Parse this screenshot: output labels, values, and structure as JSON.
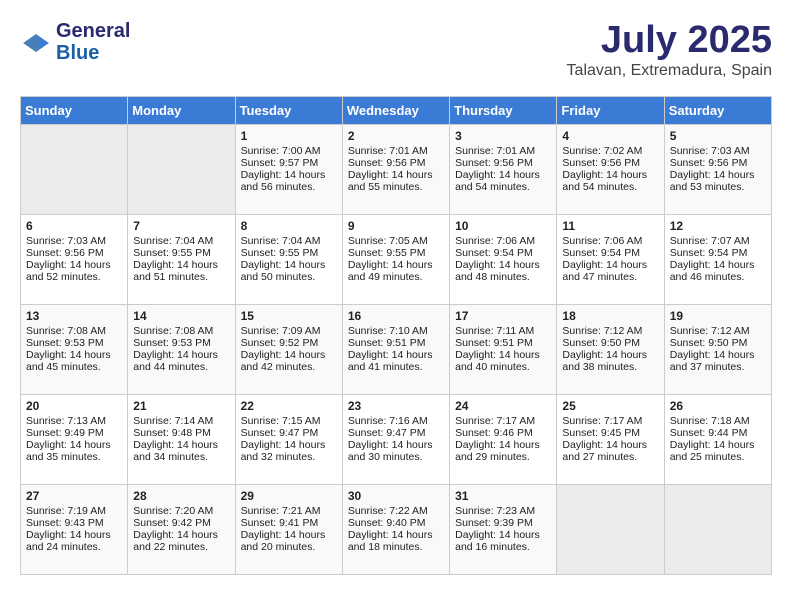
{
  "header": {
    "logo_line1": "General",
    "logo_line2": "Blue",
    "month": "July 2025",
    "location": "Talavan, Extremadura, Spain"
  },
  "weekdays": [
    "Sunday",
    "Monday",
    "Tuesday",
    "Wednesday",
    "Thursday",
    "Friday",
    "Saturday"
  ],
  "weeks": [
    [
      {
        "day": "",
        "sunrise": "",
        "sunset": "",
        "daylight": ""
      },
      {
        "day": "",
        "sunrise": "",
        "sunset": "",
        "daylight": ""
      },
      {
        "day": "1",
        "sunrise": "Sunrise: 7:00 AM",
        "sunset": "Sunset: 9:57 PM",
        "daylight": "Daylight: 14 hours and 56 minutes."
      },
      {
        "day": "2",
        "sunrise": "Sunrise: 7:01 AM",
        "sunset": "Sunset: 9:56 PM",
        "daylight": "Daylight: 14 hours and 55 minutes."
      },
      {
        "day": "3",
        "sunrise": "Sunrise: 7:01 AM",
        "sunset": "Sunset: 9:56 PM",
        "daylight": "Daylight: 14 hours and 54 minutes."
      },
      {
        "day": "4",
        "sunrise": "Sunrise: 7:02 AM",
        "sunset": "Sunset: 9:56 PM",
        "daylight": "Daylight: 14 hours and 54 minutes."
      },
      {
        "day": "5",
        "sunrise": "Sunrise: 7:03 AM",
        "sunset": "Sunset: 9:56 PM",
        "daylight": "Daylight: 14 hours and 53 minutes."
      }
    ],
    [
      {
        "day": "6",
        "sunrise": "Sunrise: 7:03 AM",
        "sunset": "Sunset: 9:56 PM",
        "daylight": "Daylight: 14 hours and 52 minutes."
      },
      {
        "day": "7",
        "sunrise": "Sunrise: 7:04 AM",
        "sunset": "Sunset: 9:55 PM",
        "daylight": "Daylight: 14 hours and 51 minutes."
      },
      {
        "day": "8",
        "sunrise": "Sunrise: 7:04 AM",
        "sunset": "Sunset: 9:55 PM",
        "daylight": "Daylight: 14 hours and 50 minutes."
      },
      {
        "day": "9",
        "sunrise": "Sunrise: 7:05 AM",
        "sunset": "Sunset: 9:55 PM",
        "daylight": "Daylight: 14 hours and 49 minutes."
      },
      {
        "day": "10",
        "sunrise": "Sunrise: 7:06 AM",
        "sunset": "Sunset: 9:54 PM",
        "daylight": "Daylight: 14 hours and 48 minutes."
      },
      {
        "day": "11",
        "sunrise": "Sunrise: 7:06 AM",
        "sunset": "Sunset: 9:54 PM",
        "daylight": "Daylight: 14 hours and 47 minutes."
      },
      {
        "day": "12",
        "sunrise": "Sunrise: 7:07 AM",
        "sunset": "Sunset: 9:54 PM",
        "daylight": "Daylight: 14 hours and 46 minutes."
      }
    ],
    [
      {
        "day": "13",
        "sunrise": "Sunrise: 7:08 AM",
        "sunset": "Sunset: 9:53 PM",
        "daylight": "Daylight: 14 hours and 45 minutes."
      },
      {
        "day": "14",
        "sunrise": "Sunrise: 7:08 AM",
        "sunset": "Sunset: 9:53 PM",
        "daylight": "Daylight: 14 hours and 44 minutes."
      },
      {
        "day": "15",
        "sunrise": "Sunrise: 7:09 AM",
        "sunset": "Sunset: 9:52 PM",
        "daylight": "Daylight: 14 hours and 42 minutes."
      },
      {
        "day": "16",
        "sunrise": "Sunrise: 7:10 AM",
        "sunset": "Sunset: 9:51 PM",
        "daylight": "Daylight: 14 hours and 41 minutes."
      },
      {
        "day": "17",
        "sunrise": "Sunrise: 7:11 AM",
        "sunset": "Sunset: 9:51 PM",
        "daylight": "Daylight: 14 hours and 40 minutes."
      },
      {
        "day": "18",
        "sunrise": "Sunrise: 7:12 AM",
        "sunset": "Sunset: 9:50 PM",
        "daylight": "Daylight: 14 hours and 38 minutes."
      },
      {
        "day": "19",
        "sunrise": "Sunrise: 7:12 AM",
        "sunset": "Sunset: 9:50 PM",
        "daylight": "Daylight: 14 hours and 37 minutes."
      }
    ],
    [
      {
        "day": "20",
        "sunrise": "Sunrise: 7:13 AM",
        "sunset": "Sunset: 9:49 PM",
        "daylight": "Daylight: 14 hours and 35 minutes."
      },
      {
        "day": "21",
        "sunrise": "Sunrise: 7:14 AM",
        "sunset": "Sunset: 9:48 PM",
        "daylight": "Daylight: 14 hours and 34 minutes."
      },
      {
        "day": "22",
        "sunrise": "Sunrise: 7:15 AM",
        "sunset": "Sunset: 9:47 PM",
        "daylight": "Daylight: 14 hours and 32 minutes."
      },
      {
        "day": "23",
        "sunrise": "Sunrise: 7:16 AM",
        "sunset": "Sunset: 9:47 PM",
        "daylight": "Daylight: 14 hours and 30 minutes."
      },
      {
        "day": "24",
        "sunrise": "Sunrise: 7:17 AM",
        "sunset": "Sunset: 9:46 PM",
        "daylight": "Daylight: 14 hours and 29 minutes."
      },
      {
        "day": "25",
        "sunrise": "Sunrise: 7:17 AM",
        "sunset": "Sunset: 9:45 PM",
        "daylight": "Daylight: 14 hours and 27 minutes."
      },
      {
        "day": "26",
        "sunrise": "Sunrise: 7:18 AM",
        "sunset": "Sunset: 9:44 PM",
        "daylight": "Daylight: 14 hours and 25 minutes."
      }
    ],
    [
      {
        "day": "27",
        "sunrise": "Sunrise: 7:19 AM",
        "sunset": "Sunset: 9:43 PM",
        "daylight": "Daylight: 14 hours and 24 minutes."
      },
      {
        "day": "28",
        "sunrise": "Sunrise: 7:20 AM",
        "sunset": "Sunset: 9:42 PM",
        "daylight": "Daylight: 14 hours and 22 minutes."
      },
      {
        "day": "29",
        "sunrise": "Sunrise: 7:21 AM",
        "sunset": "Sunset: 9:41 PM",
        "daylight": "Daylight: 14 hours and 20 minutes."
      },
      {
        "day": "30",
        "sunrise": "Sunrise: 7:22 AM",
        "sunset": "Sunset: 9:40 PM",
        "daylight": "Daylight: 14 hours and 18 minutes."
      },
      {
        "day": "31",
        "sunrise": "Sunrise: 7:23 AM",
        "sunset": "Sunset: 9:39 PM",
        "daylight": "Daylight: 14 hours and 16 minutes."
      },
      {
        "day": "",
        "sunrise": "",
        "sunset": "",
        "daylight": ""
      },
      {
        "day": "",
        "sunrise": "",
        "sunset": "",
        "daylight": ""
      }
    ]
  ]
}
